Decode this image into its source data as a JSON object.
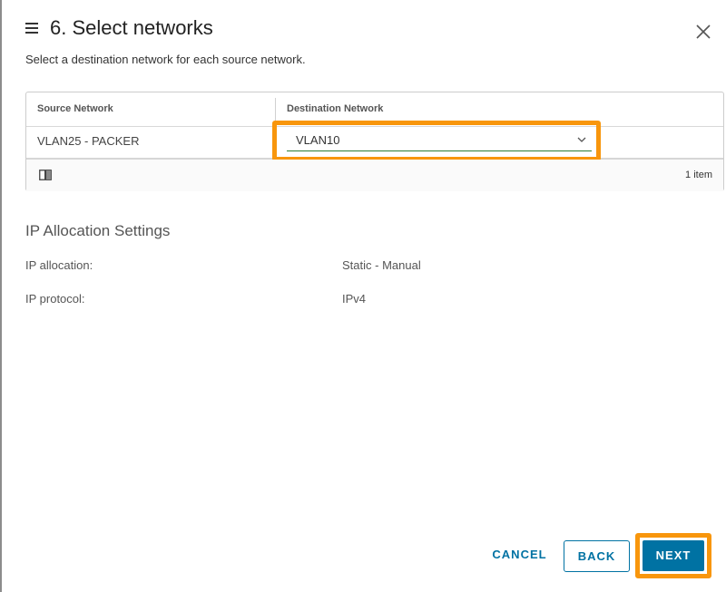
{
  "header": {
    "title": "6. Select networks"
  },
  "subtitle": "Select a destination network for each source network.",
  "grid": {
    "columns": [
      "Source Network",
      "Destination Network"
    ],
    "rows": [
      {
        "source": "VLAN25 - PACKER",
        "destination": "VLAN10"
      }
    ],
    "item_count": "1 item"
  },
  "ip_settings": {
    "title": "IP Allocation Settings",
    "fields": [
      {
        "label": "IP allocation:",
        "value": "Static - Manual"
      },
      {
        "label": "IP protocol:",
        "value": "IPv4"
      }
    ]
  },
  "footer": {
    "cancel_label": "CANCEL",
    "back_label": "BACK",
    "next_label": "NEXT"
  },
  "colors": {
    "primary": "#0072a3",
    "highlight": "#f8960c",
    "select_underline": "#2a7d36"
  }
}
